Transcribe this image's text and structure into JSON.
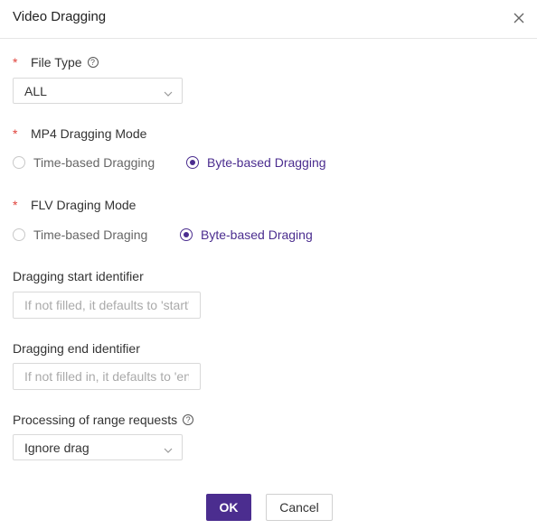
{
  "dialog": {
    "title": "Video Dragging",
    "close_icon": "close-icon"
  },
  "file_type": {
    "required_mark": "*",
    "label": "File Type",
    "help_icon": "question-circle-icon",
    "help_glyph": "?",
    "selected": "ALL"
  },
  "mp4_mode": {
    "required_mark": "*",
    "label": "MP4 Dragging Mode",
    "options": [
      {
        "label": "Time-based Dragging",
        "selected": false
      },
      {
        "label": "Byte-based Dragging",
        "selected": true
      }
    ]
  },
  "flv_mode": {
    "required_mark": "*",
    "label": "FLV Draging Mode",
    "options": [
      {
        "label": "Time-based Draging",
        "selected": false
      },
      {
        "label": "Byte-based Draging",
        "selected": true
      }
    ]
  },
  "start_identifier": {
    "label": "Dragging start identifier",
    "value": "",
    "placeholder": "If not filled, it defaults to 'start'"
  },
  "end_identifier": {
    "label": "Dragging end identifier",
    "value": "",
    "placeholder": "If not filled in, it defaults to 'end'"
  },
  "range_requests": {
    "label": "Processing of range requests",
    "help_icon": "question-circle-icon",
    "help_glyph": "?",
    "selected": "Ignore drag"
  },
  "footer": {
    "ok_label": "OK",
    "cancel_label": "Cancel"
  },
  "colors": {
    "accent": "#4b2d8f",
    "required": "#e0433c",
    "border": "#d9d9d9"
  }
}
